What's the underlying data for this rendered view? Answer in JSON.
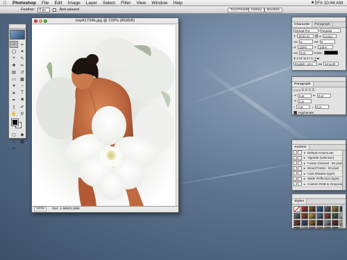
{
  "menubar": {
    "app": "Photoshop",
    "items": [
      "File",
      "Edit",
      "Image",
      "Layer",
      "Select",
      "Filter",
      "View",
      "Window",
      "Help"
    ],
    "clock": "Fri 10:44 AM"
  },
  "options_bar": {
    "feather_label": "Feather:",
    "feather_value": "0 px",
    "antialiased_label": "Anti-aliased",
    "well_buttons": [
      "Tool Presets",
      "History",
      "Brushes"
    ]
  },
  "document": {
    "title": "bxp41734b.jpg @ 100% (RGB/8)",
    "zoom": "100%",
    "doc_size": "Doc: 1.58M/1.58M"
  },
  "character_palette": {
    "tabs": [
      "Character",
      "Paragraph"
    ],
    "font": "Myriad Pro",
    "style": "Regular",
    "size": "18.52 pt",
    "leading": "(Auto)",
    "kerning": "0",
    "tracking": "0",
    "vscale": "100%",
    "hscale": "100%",
    "baseline": "0 pt",
    "color_label": "Color:",
    "language": "English: USA",
    "antialias": "Smooth"
  },
  "paragraph_palette": {
    "tabs": [
      "Paragraph"
    ],
    "indents": [
      "0 pt",
      "0 pt",
      "0 pt",
      "0 pt",
      "0 pt"
    ],
    "hyphenate": "Hyphenate"
  },
  "actions_palette": {
    "tabs": [
      "Actions"
    ],
    "set_name": "Default Actions.atn",
    "items": [
      "Vignette (selection)",
      "Frame Channel - 50 pixel",
      "Wood Frame - 50 pixel",
      "Cast Shadow (type)",
      "Water Reflection (type)",
      "Custom RGB to Grayscale"
    ]
  },
  "styles_palette": {
    "tabs": [
      "Styles"
    ],
    "swatch_colors": [
      "#ffffff",
      "#c0392b",
      "#8e5a2b",
      "#2f6db5",
      "#6a6a6a",
      "#b5892f",
      "#444444",
      "#7d7d7d",
      "#a34a24",
      "#d9a441",
      "#5a7fb0",
      "#b33c3c",
      "#3f6f3f",
      "#c9c9c9",
      "#8a3f2f",
      "#4b4b7a",
      "#b07a2a",
      "#3a3a3a",
      "#9aa7b8",
      "#6e2f2f",
      "#d2b48c",
      "#2f4f4f",
      "#a0a0a0",
      "#7a4a9a",
      "#c56b3a",
      "#5a5a2a",
      "#1f3f6f",
      "#e0e0e0"
    ]
  }
}
